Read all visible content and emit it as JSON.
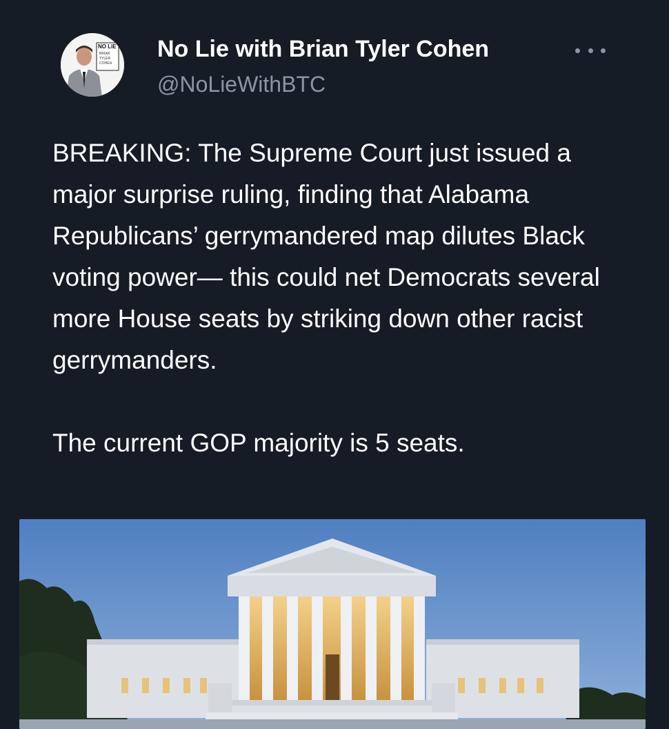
{
  "tweet": {
    "author": {
      "name": "No Lie with Brian Tyler Cohen",
      "handle": "@NoLieWithBTC",
      "avatar_logo_text": "NO LIE with BRIAN TYLER COHEN"
    },
    "more_icon": "more-horizontal-icon",
    "text": "BREAKING: The Supreme Court just issued a major surprise ruling, finding that Alabama Republicans’ gerrymandered map dilutes Black voting power— this could net Democrats several more House seats by striking down other racist gerrymanders.\n\nThe current GOP majority is 5 seats.",
    "media": {
      "subject": "supreme-court-building-photo"
    }
  },
  "colors": {
    "background": "#161c26",
    "text_primary": "#ffffff",
    "text_secondary": "#8a96a3"
  }
}
